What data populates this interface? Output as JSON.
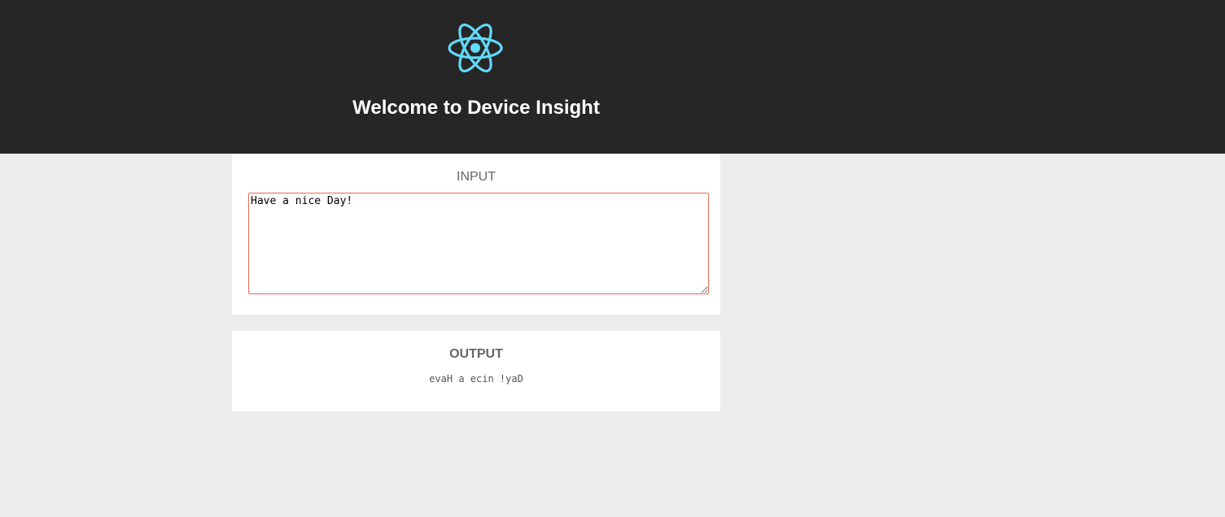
{
  "header": {
    "logo_icon": "react-atom-icon",
    "logo_color": "#61dafb",
    "title": "Welcome to Device Insight"
  },
  "input_panel": {
    "heading": "INPUT",
    "value": "Have a nice Day!",
    "border_color": "#e86a4f"
  },
  "output_panel": {
    "heading": "OUTPUT",
    "result": "evaH a ecin !yaD"
  }
}
